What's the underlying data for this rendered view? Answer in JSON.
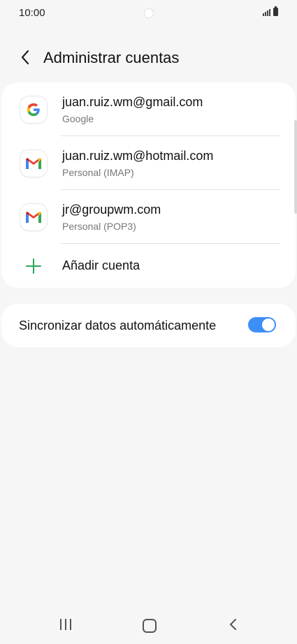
{
  "status_bar": {
    "time": "10:00"
  },
  "header": {
    "title": "Administrar cuentas",
    "back_icon": "chevron-left-icon"
  },
  "accounts": [
    {
      "email": "juan.ruiz.wm@gmail.com",
      "type": "Google",
      "icon": "google-icon"
    },
    {
      "email": "juan.ruiz.wm@hotmail.com",
      "type": "Personal (IMAP)",
      "icon": "gmail-icon"
    },
    {
      "email": "jr@groupwm.com",
      "type": "Personal (POP3)",
      "icon": "gmail-icon"
    }
  ],
  "add_account": {
    "label": "Añadir cuenta",
    "icon": "plus-icon",
    "icon_color": "#2aa55a"
  },
  "sync": {
    "label": "Sincronizar datos automáticamente",
    "enabled": true,
    "toggle_color": "#3e8ef7"
  },
  "nav_bar": {
    "recents_icon": "recents-icon",
    "home_icon": "home-icon",
    "back_icon": "back-icon"
  }
}
